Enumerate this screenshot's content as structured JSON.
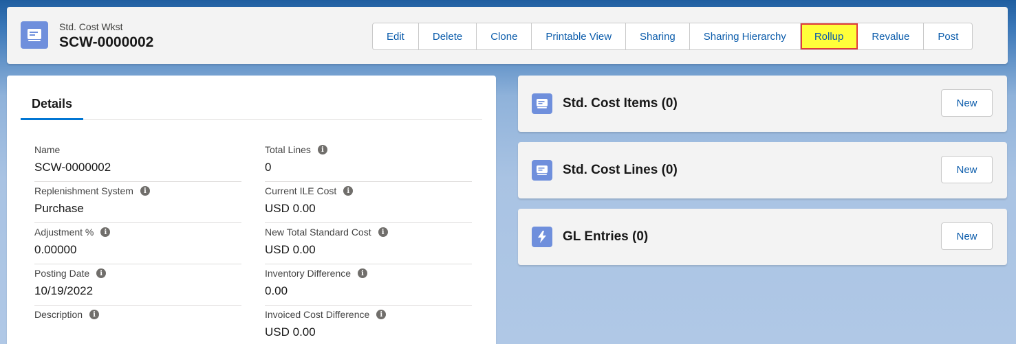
{
  "header": {
    "icon": "record-icon",
    "object_type": "Std. Cost Wkst",
    "record_name": "SCW-0000002",
    "actions": [
      "Edit",
      "Delete",
      "Clone",
      "Printable View",
      "Sharing",
      "Sharing Hierarchy",
      "Rollup",
      "Revalue",
      "Post"
    ],
    "highlighted_action": "Rollup"
  },
  "details": {
    "tab_label": "Details",
    "left_fields": [
      {
        "label": "Name",
        "value": "SCW-0000002",
        "has_info": false
      },
      {
        "label": "Replenishment System",
        "value": "Purchase",
        "has_info": true
      },
      {
        "label": "Adjustment %",
        "value": "0.00000",
        "has_info": true
      },
      {
        "label": "Posting Date",
        "value": "10/19/2022",
        "has_info": true
      },
      {
        "label": "Description",
        "value": "",
        "has_info": true
      }
    ],
    "right_fields": [
      {
        "label": "Total Lines",
        "value": "0",
        "has_info": true
      },
      {
        "label": "Current ILE Cost",
        "value": "USD 0.00",
        "has_info": true
      },
      {
        "label": "New Total Standard Cost",
        "value": "USD 0.00",
        "has_info": true
      },
      {
        "label": "Inventory Difference",
        "value": "0.00",
        "has_info": true
      },
      {
        "label": "Invoiced Cost Difference",
        "value": "USD 0.00",
        "has_info": true
      }
    ]
  },
  "related_lists": [
    {
      "title": "Std. Cost Items (0)",
      "icon": "record-icon",
      "icon_color": "#6f8fdc",
      "button": "New"
    },
    {
      "title": "Std. Cost Lines (0)",
      "icon": "record-icon",
      "icon_color": "#6f8fdc",
      "button": "New"
    },
    {
      "title": "GL Entries (0)",
      "icon": "lightning-icon",
      "icon_color": "#6f8fdc",
      "button": "New"
    }
  ],
  "colors": {
    "link": "#0b5cab",
    "highlight_fill": "#ffff3a",
    "highlight_border": "#e03b3b",
    "tab_underline": "#0176d3"
  }
}
